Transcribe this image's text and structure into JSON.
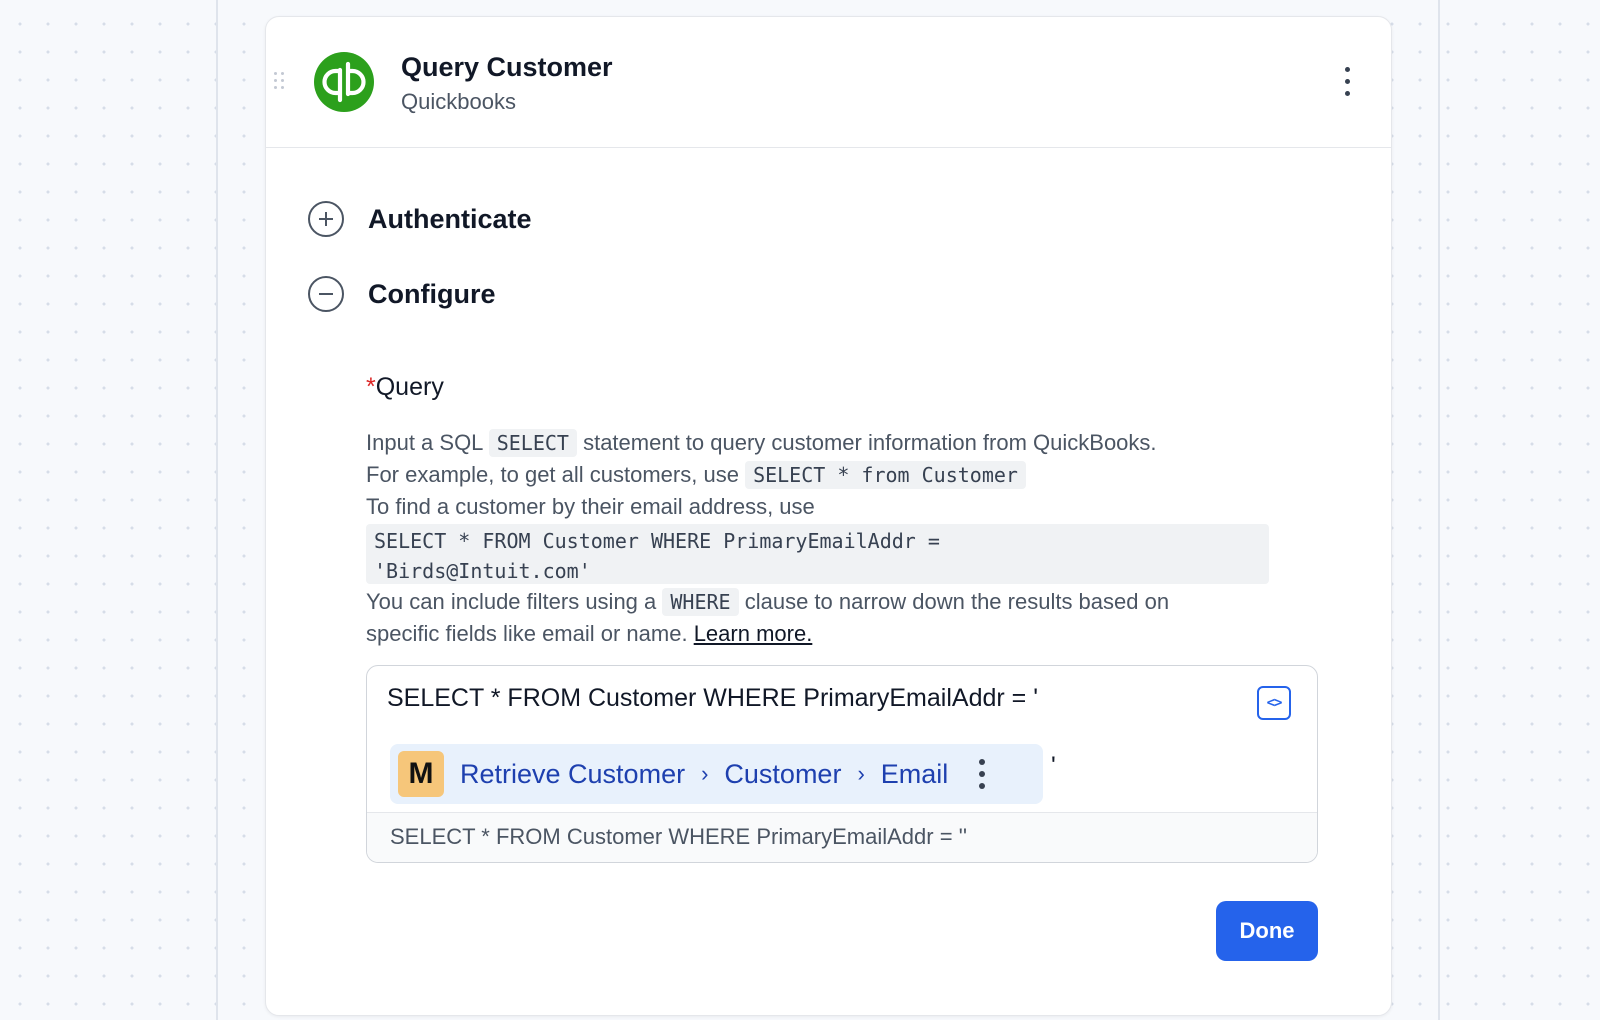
{
  "step": {
    "title": "Query Customer",
    "app_name": "Quickbooks",
    "logo_color": "#2ca01c"
  },
  "sections": [
    {
      "label": "Authenticate",
      "state": "collapsed",
      "icon": "plus-circle-icon"
    },
    {
      "label": "Configure",
      "state": "expanded",
      "icon": "minus-circle-icon"
    }
  ],
  "field": {
    "required_marker": "*",
    "label": "Query",
    "description": {
      "l1_a": "Input a SQL ",
      "l1_code": "SELECT",
      "l1_b": " statement to query customer information from QuickBooks.",
      "l2_a": "For example, to get all customers, use ",
      "l2_code": "SELECT * from Customer",
      "l3": "To find a customer by their email address, use",
      "code_block_l1": "SELECT * FROM Customer WHERE PrimaryEmailAddr =",
      "code_block_l2": "'Birds@Intuit.com'",
      "l4_a": "You can include filters using a ",
      "l4_code": "WHERE",
      "l4_b": " clause to narrow down the results based on",
      "l5_a": "specific fields like email or name. ",
      "learn_more": "Learn more."
    }
  },
  "editor": {
    "text_line1": "SELECT * FROM Customer WHERE PrimaryEmailAddr = '",
    "code_toggle_glyph": "<>",
    "variable": {
      "logo_letter": "M",
      "logo_color": "#f6c67a",
      "path": [
        "Retrieve Customer",
        "Customer",
        "Email"
      ],
      "separator": "›"
    },
    "trailing_text": "'",
    "preview": "SELECT * FROM Customer WHERE PrimaryEmailAddr = ''"
  },
  "actions": {
    "done_label": "Done",
    "accent_color": "#2563eb"
  }
}
